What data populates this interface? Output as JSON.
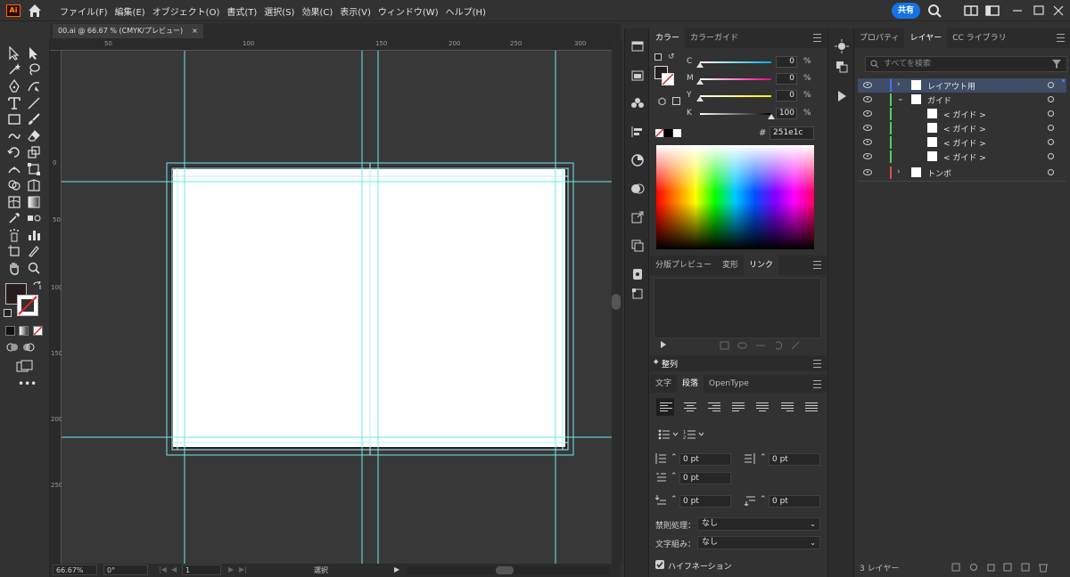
{
  "app": {
    "logo": "Ai",
    "menus": [
      "ファイル(F)",
      "編集(E)",
      "オブジェクト(O)",
      "書式(T)",
      "選択(S)",
      "効果(C)",
      "表示(V)",
      "ウィンドウ(W)",
      "ヘルプ(H)"
    ],
    "share_label": "共有"
  },
  "document": {
    "tab_title": "00.ai @ 66.67 % (CMYK/プレビュー)",
    "tab_close": "×"
  },
  "rulers": {
    "top": [
      "50",
      "100",
      "150",
      "200",
      "250",
      "300"
    ],
    "left": [
      "0",
      "50",
      "100",
      "150",
      "200",
      "250"
    ]
  },
  "status": {
    "zoom": "66.67%",
    "rotate": "0°",
    "artboard": "1",
    "tool": "選択",
    "first": "|◀",
    "prev": "◀",
    "next": "▶",
    "last": "▶|",
    "play": "▶"
  },
  "color_panel": {
    "tabs": [
      "カラー",
      "カラーガイド"
    ],
    "channels": [
      {
        "label": "C",
        "value": "0",
        "unit": "%"
      },
      {
        "label": "M",
        "value": "0",
        "unit": "%"
      },
      {
        "label": "Y",
        "value": "0",
        "unit": "%"
      },
      {
        "label": "K",
        "value": "100",
        "unit": "%"
      }
    ],
    "hex_label": "#",
    "hex_value": "251e1c"
  },
  "link_panel": {
    "tabs": [
      "分版プレビュー",
      "変形",
      "リンク"
    ]
  },
  "align_panel": {
    "title": "整列"
  },
  "paragraph_panel": {
    "tabs": [
      "文字",
      "段落",
      "OpenType"
    ],
    "left_indent": "0 pt",
    "right_indent": "0 pt",
    "first_line_indent": "0 pt",
    "space_before": "0 pt",
    "space_after": "0 pt",
    "kinsoku_label": "禁則処理：",
    "kinsoku_value": "なし",
    "mojikumi_label": "文字組み：",
    "mojikumi_value": "なし",
    "hyphenation_label": "ハイフネーション"
  },
  "layers_panel": {
    "tabs": [
      "プロパティ",
      "レイヤー",
      "CC ライブラリ"
    ],
    "search_placeholder": "すべてを検索",
    "rows": [
      {
        "name": "レイアウト用",
        "color": "#4f6df5"
      },
      {
        "name": "ガイド",
        "color": "#4fd15a"
      },
      {
        "name": "< ガイド >",
        "color": "#4fd15a"
      },
      {
        "name": "< ガイド >",
        "color": "#4fd15a"
      },
      {
        "name": "< ガイド >",
        "color": "#4fd15a"
      },
      {
        "name": "< ガイド >",
        "color": "#4fd15a"
      },
      {
        "name": "トンボ",
        "color": "#e34a4a"
      }
    ],
    "footer": "3 レイヤー"
  },
  "colors": {
    "accent": "#1473e6",
    "guide": "#6ee7f0",
    "fill": "#251e1c"
  }
}
